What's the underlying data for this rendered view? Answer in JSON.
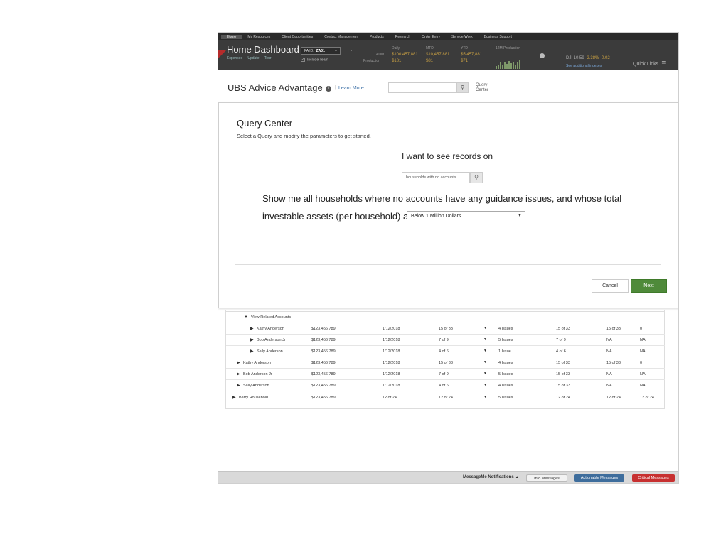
{
  "topnav": {
    "items": [
      "Home",
      "My Resources",
      "Client Opportunities",
      "Contact Management",
      "Products",
      "Research",
      "Order Entry",
      "Service Work",
      "Business Support"
    ],
    "active_index": 0
  },
  "header": {
    "title": "Home Dashboard",
    "sub_links": [
      "Expenses",
      "Update",
      "Tour"
    ],
    "fa_label": "FA ID:",
    "fa_value": "ZA01",
    "include_label": "Include Team",
    "metrics": [
      {
        "label": "Daily",
        "value": "$100,457,881",
        "value2": "$181"
      },
      {
        "label": "MTD",
        "value": "$10,457,881",
        "value2": "$81"
      },
      {
        "label": "YTD",
        "value": "$5,457,881",
        "value2": "$71"
      }
    ],
    "aum_label": "AUM",
    "production_label": "Production",
    "chart_label": "12M Production",
    "market": {
      "index": "DJI",
      "time": "10:59",
      "change_pct": "2.38%",
      "change_abs": "0.02"
    },
    "market_link": "See additional indexes",
    "quick_links": "Quick Links"
  },
  "advice": {
    "title": "UBS Advice Advantage",
    "learn_more": "Learn More",
    "search_placeholder": "",
    "query_center_line1": "Query",
    "query_center_line2": "Center"
  },
  "modal": {
    "title": "Query Center",
    "subtitle": "Select a Query and modify the parameters to get started.",
    "want_text": "I want to see records on",
    "records_value": "households with no accounts",
    "sentence_line1": "Show me all households where no accounts have any guidance issues, and whose total",
    "sentence_line2": "investable assets (per household) are",
    "select_value": "Below 1 Million Dollars",
    "cancel_label": "Cancel",
    "next_label": "Next"
  },
  "table": {
    "view_related": "View Related Accounts",
    "rows": [
      {
        "name": "Kathy Anderson",
        "amount": "$123,456,789",
        "date": "1/12/2018",
        "c1": "15 of 33",
        "issues": "4 Issues",
        "c2": "15 of 33",
        "c3": "15 of 33",
        "c4": "0",
        "indent": 2
      },
      {
        "name": "Bob Anderson Jr",
        "amount": "$123,456,789",
        "date": "1/12/2018",
        "c1": "7 of 9",
        "issues": "5 Issues",
        "c2": "7 of 9",
        "c3": "NA",
        "c4": "NA",
        "indent": 2
      },
      {
        "name": "Sally Anderson",
        "amount": "$123,456,789",
        "date": "1/12/2018",
        "c1": "4 of 6",
        "issues": "1 Issue",
        "c2": "4 of 6",
        "c3": "NA",
        "c4": "NA",
        "indent": 2
      },
      {
        "name": "Kathy Anderson",
        "amount": "$123,456,789",
        "date": "1/12/2018",
        "c1": "15 of 33",
        "issues": "4 Issues",
        "c2": "15 of 33",
        "c3": "15 of 33",
        "c4": "0",
        "indent": 1
      },
      {
        "name": "Bob Anderson Jr",
        "amount": "$123,456,789",
        "date": "1/12/2018",
        "c1": "7 of 9",
        "issues": "5 Issues",
        "c2": "15 of 33",
        "c3": "NA",
        "c4": "NA",
        "indent": 1
      },
      {
        "name": "Sally Anderson",
        "amount": "$123,456,789",
        "date": "1/12/2018",
        "c1": "4 of 6",
        "issues": "4 Issues",
        "c2": "15 of 33",
        "c3": "NA",
        "c4": "NA",
        "indent": 1
      },
      {
        "name": "Barry Household",
        "amount": "$123,456,789",
        "date": "12 of 24",
        "c1": "12 of 24",
        "issues": "5 Issues",
        "c2": "12 of 24",
        "c3": "12 of 24",
        "c4": "12 of 24",
        "indent": 0
      }
    ]
  },
  "footer": {
    "messageme": "MessageMe Notifications",
    "info": "Info Messages",
    "actionable": "Actionable Messages",
    "critical": "Critical Messages"
  },
  "colors": {
    "next_button": "#4f8a3a",
    "actionable": "#3e6d9c",
    "critical": "#c73030",
    "link": "#3a6ea5",
    "header_bg": "#3b3b3b"
  }
}
